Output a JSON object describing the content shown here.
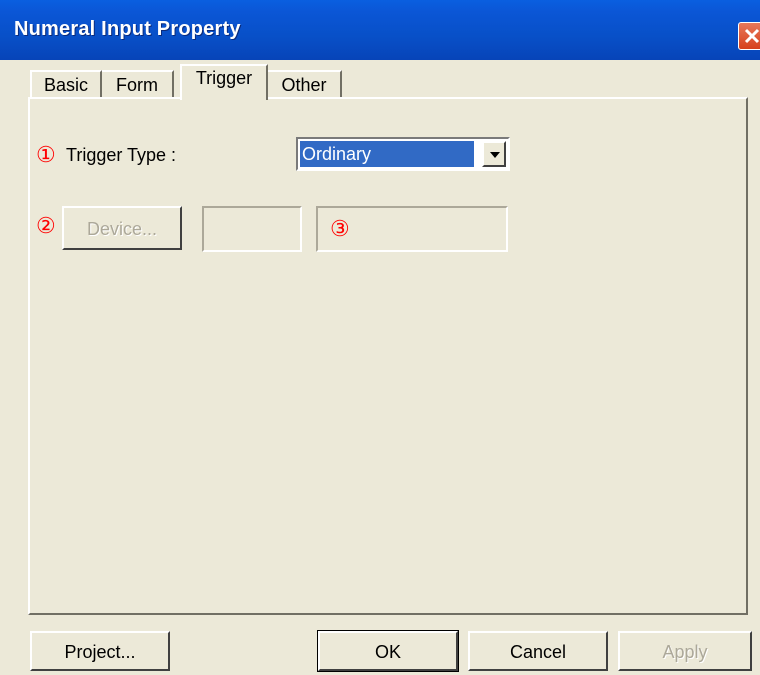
{
  "window": {
    "title": "Numeral Input Property",
    "close_icon": "close-icon"
  },
  "tabs": [
    {
      "label": "Basic",
      "active": false
    },
    {
      "label": "Form",
      "active": false
    },
    {
      "label": "Trigger",
      "active": true
    },
    {
      "label": "Other",
      "active": false
    }
  ],
  "trigger": {
    "marker1": "①",
    "type_label": "Trigger Type :",
    "type_value": "Ordinary",
    "marker2": "②",
    "device_button": "Device...",
    "device_field": "",
    "marker3": "③",
    "address_field": ""
  },
  "footer": {
    "project_button": "Project...",
    "ok_button": "OK",
    "cancel_button": "Cancel",
    "apply_button": "Apply"
  },
  "colors": {
    "titlebar": "#0852d0",
    "face": "#ece9d8",
    "selection": "#316ac5",
    "marker": "#ff0000",
    "close_button": "#d6401c"
  }
}
